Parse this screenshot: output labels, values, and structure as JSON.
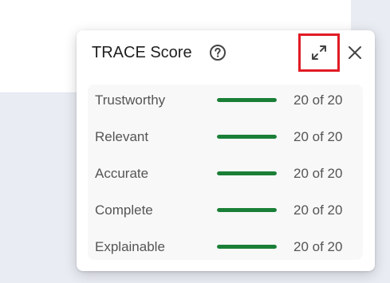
{
  "popover": {
    "title": "TRACE Score",
    "help_icon": "question-circle-icon",
    "expand_icon": "expand-arrows-icon",
    "close_icon": "close-x-icon"
  },
  "scores": [
    {
      "label": "Trustworthy",
      "value_text": "20 of 20",
      "score": 20,
      "max": 20
    },
    {
      "label": "Relevant",
      "value_text": "20 of 20",
      "score": 20,
      "max": 20
    },
    {
      "label": "Accurate",
      "value_text": "20 of 20",
      "score": 20,
      "max": 20
    },
    {
      "label": "Complete",
      "value_text": "20 of 20",
      "score": 20,
      "max": 20
    },
    {
      "label": "Explainable",
      "value_text": "20 of 20",
      "score": 20,
      "max": 20
    }
  ],
  "colors": {
    "bar_fill": "#1a7f37",
    "highlight": "#e01b24"
  }
}
